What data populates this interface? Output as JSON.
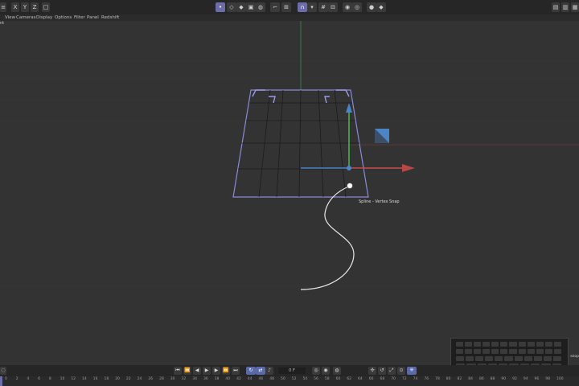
{
  "toolbar": {
    "axis_x": "X",
    "axis_y": "Y",
    "axis_z": "Z"
  },
  "menu": {
    "items": [
      "View",
      "Cameras",
      "Display",
      "Options",
      "Filter",
      "Panel",
      "Redshift"
    ]
  },
  "viewport": {
    "label": "nt",
    "tooltip": "Spline - Vertex Snap"
  },
  "timeline": {
    "current_frame": "0 F",
    "ticks": [
      "0",
      "2",
      "4",
      "6",
      "8",
      "10",
      "12",
      "14",
      "16",
      "18",
      "20",
      "22",
      "24",
      "26",
      "28",
      "30",
      "32",
      "34",
      "36",
      "38",
      "40",
      "42",
      "44",
      "46",
      "48",
      "50",
      "52",
      "54",
      "56",
      "58",
      "60",
      "62",
      "64",
      "66",
      "68",
      "70",
      "72",
      "74",
      "76",
      "78",
      "80",
      "82",
      "84",
      "86",
      "88",
      "90",
      "92",
      "94",
      "96",
      "98",
      "100"
    ]
  },
  "overlay": {
    "side_label": "ezop"
  },
  "colors": {
    "accent": "#6c6ca8",
    "grid_outline": "#8a8ad8",
    "axis_x": "#c84c4c",
    "axis_y": "#4caf50",
    "axis_z": "#4c84c8"
  }
}
